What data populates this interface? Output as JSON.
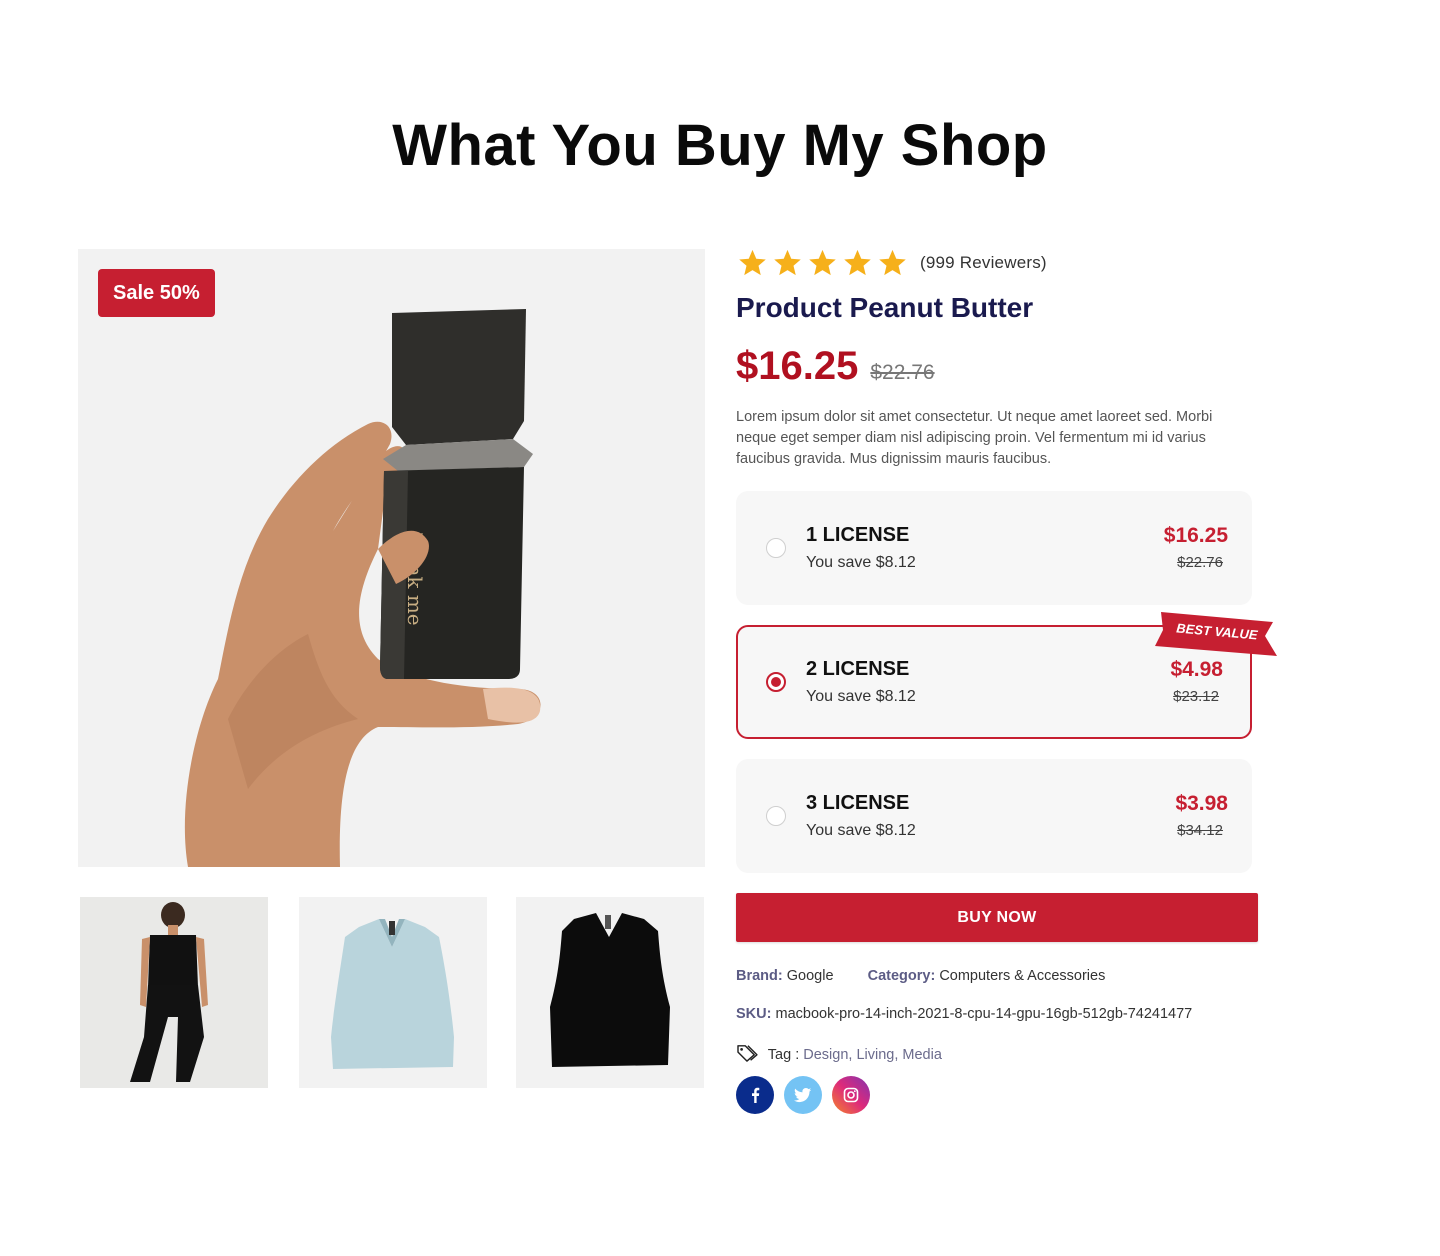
{
  "section": {
    "title": "What You Buy My Shop"
  },
  "gallery": {
    "badge": "Sale 50%",
    "product_label": "blank me",
    "thumbnails": [
      "model-in-black-vest",
      "light-blue-knit-vest",
      "black-knit-vest"
    ]
  },
  "product": {
    "rating": 5,
    "reviews": "(999 Reviewers)",
    "name": "Product Peanut Butter",
    "price": "$16.25",
    "old_price": "$22.76",
    "description": "Lorem ipsum dolor sit amet consectetur. Ut neque amet laoreet sed. Morbi neque eget semper diam nisl adipiscing proin. Vel fermentum mi id varius faucibus gravida. Mus dignissim mauris faucibus."
  },
  "licenses": [
    {
      "name": "1 LICENSE",
      "save": "You save $8.12",
      "price": "$16.25",
      "old_price": "$22.76",
      "selected": false
    },
    {
      "name": "2 LICENSE",
      "save": "You save $8.12",
      "price": "$4.98",
      "old_price": "$23.12",
      "selected": true
    },
    {
      "name": "3 LICENSE",
      "save": "You save $8.12",
      "price": "$3.98",
      "old_price": "$34.12",
      "selected": false
    }
  ],
  "ribbon": "BEST VALUE",
  "buy_button": "BUY NOW",
  "meta": {
    "brand_label": "Brand:",
    "brand_value": "Google",
    "category_label": "Category:",
    "category_value": "Computers & Accessories",
    "sku_label": "SKU:",
    "sku_value": "macbook-pro-14-inch-2021-8-cpu-14-gpu-16gb-512gb-74241477",
    "tag_label": "Tag :",
    "tags": [
      "Design,",
      "Living,",
      "Media"
    ]
  },
  "social": [
    {
      "icon": "facebook-icon",
      "color": "#0a2c8c"
    },
    {
      "icon": "twitter-icon",
      "color": "#74c3f4"
    },
    {
      "icon": "instagram-icon",
      "color": "#c13584"
    }
  ],
  "colors": {
    "accent": "#c61f31",
    "star": "#f6b01a",
    "title": "#1a1a4e"
  }
}
